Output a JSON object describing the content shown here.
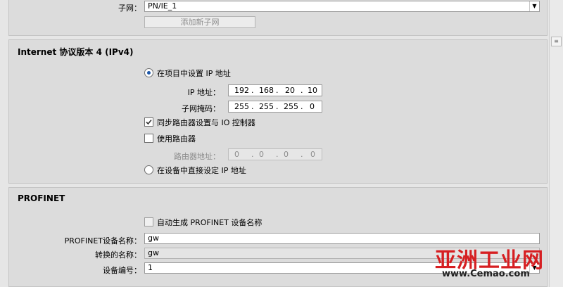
{
  "subnet": {
    "label": "子网：",
    "value": "PN/IE_1",
    "add_button": "添加新子网"
  },
  "ipv4": {
    "title": "Internet 协议版本 4 (IPv4)",
    "opt_project": "在项目中设置 IP 地址",
    "ip_label": "IP 地址：",
    "ip": [
      "192",
      "168",
      "20",
      "10"
    ],
    "mask_label": "子网掩码：",
    "mask": [
      "255",
      "255",
      "255",
      "0"
    ],
    "sync_label": "同步路由器设置与 IO 控制器",
    "use_router_label": "使用路由器",
    "router_addr_label": "路由器地址：",
    "router": [
      "0",
      "0",
      "0",
      "0"
    ],
    "opt_device": "在设备中直接设定 IP 地址"
  },
  "profinet": {
    "title": "PROFINET",
    "auto_label": "自动生成 PROFINET 设备名称",
    "name_label": "PROFINET设备名称：",
    "name_value": "gw",
    "converted_label": "转换的名称：",
    "converted_value": "gw",
    "number_label": "设备编号：",
    "number_value": "1"
  },
  "watermark": {
    "main": "亚洲工业网",
    "url": "www.Cemao.com"
  },
  "icons": {
    "dropdown": "chevron-down-icon",
    "check": "checkmark-icon",
    "scroll": "scroll-thumb-icon"
  },
  "colors": {
    "radio_selected": "#1d57a8",
    "watermark": "#d61f22"
  }
}
